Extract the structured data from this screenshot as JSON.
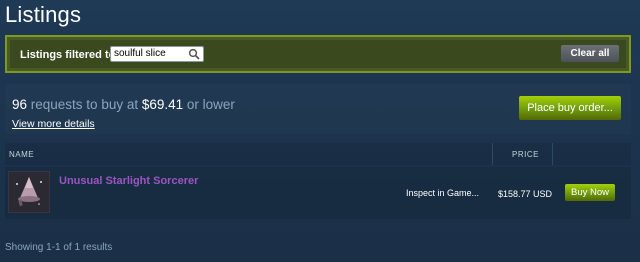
{
  "page": {
    "title": "Listings"
  },
  "filter": {
    "label": "Listings filtered to:",
    "value": "soulful slice",
    "clear_label": "Clear all"
  },
  "buy_orders": {
    "count": "96",
    "text_mid": " requests to buy at ",
    "price": "$69.41",
    "text_end": " or lower",
    "details_link": "View more details",
    "place_label": "Place buy order..."
  },
  "table": {
    "headers": {
      "name": "NAME",
      "price": "PRICE"
    },
    "rows": [
      {
        "item_name": "Unusual Starlight Sorcerer",
        "inspect_label": "Inspect in Game...",
        "price": "$158.77 USD",
        "buy_label": "Buy Now"
      }
    ]
  },
  "footer": {
    "results": "Showing 1-1 of 1 results"
  },
  "colors": {
    "accent_green": "#a4d007",
    "item_name_purple": "#9b55c3",
    "filter_border": "#7a9a22"
  },
  "icons": {
    "search": "search-icon"
  }
}
